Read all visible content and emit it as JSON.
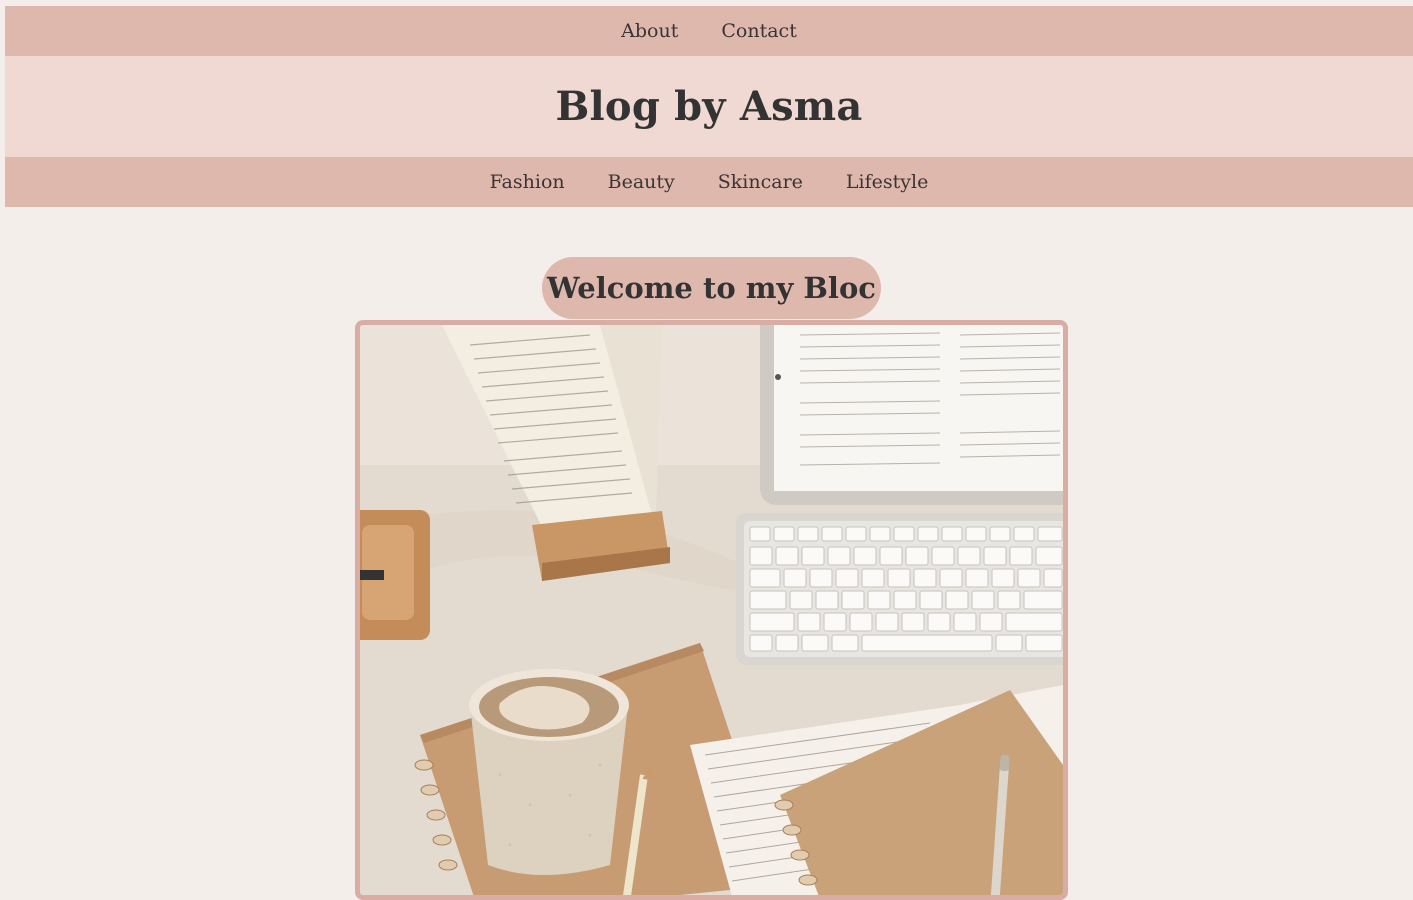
{
  "top_nav": {
    "items": [
      {
        "label": "About"
      },
      {
        "label": "Contact"
      }
    ]
  },
  "header": {
    "title": "Blog by Asma"
  },
  "category_nav": {
    "items": [
      {
        "label": "Fashion"
      },
      {
        "label": "Beauty"
      },
      {
        "label": "Skincare"
      },
      {
        "label": "Lifestyle"
      }
    ]
  },
  "main": {
    "welcome_heading": "Welcome to my Bloc",
    "hero_image_description_icon": "photo-desk-flatlay"
  },
  "colors": {
    "nav_bg": "#dfb8ad",
    "header_bg": "#f0d9d3",
    "page_bg": "#f4eeeb",
    "frame_border": "#d9ada4"
  }
}
